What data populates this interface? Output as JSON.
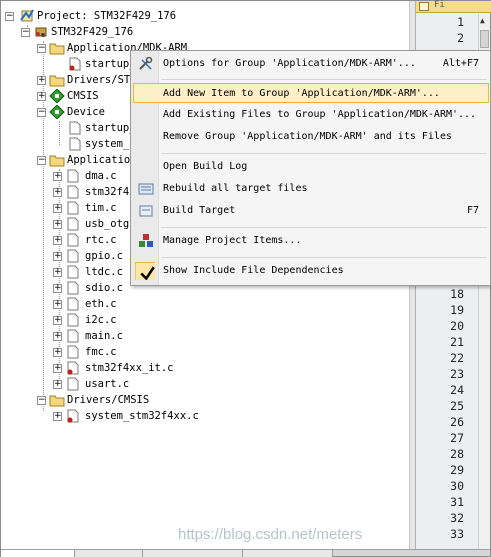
{
  "project_tree": {
    "root_label": "Project: STM32F429_176",
    "target_label": "STM32F429_176",
    "group_app_mdk": "Application/MDK-ARM",
    "file_startup_trunc": "startup_",
    "group_drivers_stm_trunc": "Drivers/STM",
    "group_cmsis": "CMSIS",
    "group_device": "Device",
    "file_device_startup": "startup_",
    "file_device_system": "system_s",
    "group_app_user_trunc": "Application",
    "files": [
      "dma.c",
      "stm32f4xx",
      "tim.c",
      "usb_otg.",
      "rtc.c",
      "gpio.c",
      "ltdc.c",
      "sdio.c",
      "eth.c",
      "i2c.c",
      "main.c",
      "fmc.c",
      "stm32f4xx_it.c",
      "usart.c"
    ],
    "group_drivers_cmsis": "Drivers/CMSIS",
    "file_system_stm32": "system_stm32f4xx.c"
  },
  "context_menu": {
    "options": "Options for Group 'Application/MDK-ARM'...",
    "options_shortcut": "Alt+F7",
    "add_new": "Add New  Item to Group 'Application/MDK-ARM'...",
    "add_existing": "Add Existing Files to Group 'Application/MDK-ARM'...",
    "remove": "Remove Group 'Application/MDK-ARM' and its Files",
    "open_build_log": "Open Build Log",
    "rebuild": "Rebuild all target files",
    "build_target": "Build Target",
    "build_shortcut": "F7",
    "manage": "Manage Project Items...",
    "show_deps": "Show Include File Dependencies"
  },
  "editor": {
    "tab_label": "Fi",
    "line_numbers": [
      "1",
      "2",
      "18",
      "19",
      "20",
      "21",
      "22",
      "23",
      "24",
      "25",
      "26",
      "27",
      "28",
      "29",
      "30",
      "31",
      "32",
      "33"
    ]
  },
  "watermark": "https://blog.csdn.net/meters",
  "colors": {
    "highlight_bg": "#fdf0c8",
    "highlight_border": "#e8b640",
    "editor_tab": "#f5dc8a"
  },
  "icons": {
    "project": "project-root-icon",
    "target": "target-icon",
    "folder": "folder-icon",
    "file": "file-icon",
    "diamond": "component-diamond-icon",
    "options": "wrench-icon",
    "rebuild": "rebuild-icon",
    "build": "build-icon",
    "manage": "manage-items-icon",
    "check": "checkmark-icon"
  }
}
